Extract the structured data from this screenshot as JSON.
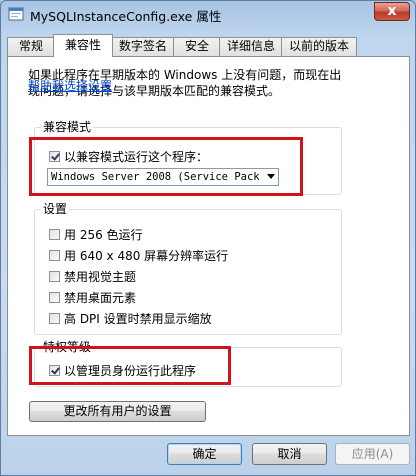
{
  "window": {
    "title": "MySQLInstanceConfig.exe 属性",
    "close_glyph": "x"
  },
  "tabs": [
    {
      "label": "常规",
      "active": false
    },
    {
      "label": "兼容性",
      "active": true
    },
    {
      "label": "数字签名",
      "active": false
    },
    {
      "label": "安全",
      "active": false
    },
    {
      "label": "详细信息",
      "active": false
    },
    {
      "label": "以前的版本",
      "active": false
    }
  ],
  "compat": {
    "intro_line1": "如果此程序在早期版本的 Windows 上没有问题，而现在出",
    "intro_line2": "现问题，请选择与该早期版本匹配的兼容模式。",
    "help_link": "帮助我选择设置"
  },
  "mode_group": {
    "title": "兼容模式",
    "checkbox_label": "以兼容模式运行这个程序：",
    "checked": true,
    "selected_os": "Windows Server 2008 (Service Pack"
  },
  "settings_group": {
    "title": "设置",
    "options": [
      {
        "label": "用 256 色运行",
        "checked": false
      },
      {
        "label": "用 640 x 480 屏幕分辨率运行",
        "checked": false
      },
      {
        "label": "禁用视觉主题",
        "checked": false
      },
      {
        "label": "禁用桌面元素",
        "checked": false
      },
      {
        "label": "高 DPI 设置时禁用显示缩放",
        "checked": false
      }
    ]
  },
  "privilege_group": {
    "title": "特权等级",
    "checkbox_label": "以管理员身份运行此程序",
    "checked": true
  },
  "all_users_button": "更改所有用户的设置",
  "footer": {
    "ok": "确定",
    "cancel": "取消",
    "apply": "应用(A)"
  },
  "colors": {
    "highlight": "#d0121b",
    "link": "#0046d5"
  }
}
